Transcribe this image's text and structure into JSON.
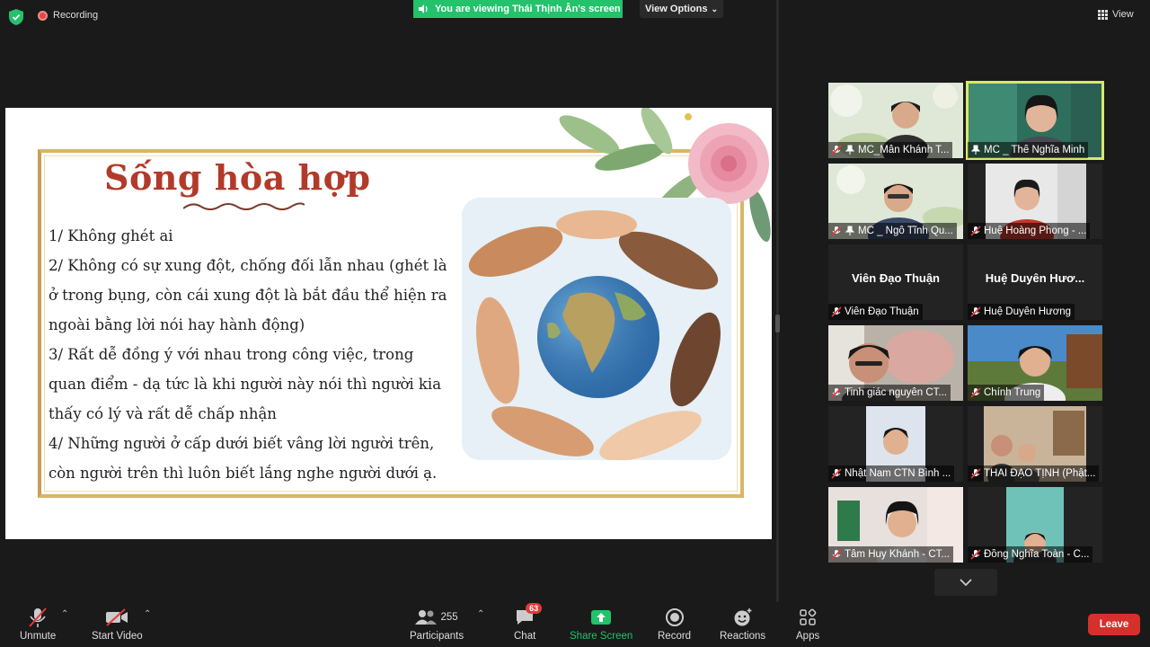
{
  "topbar": {
    "recording_label": "Recording",
    "viewing_banner": "You are viewing Thái Thịnh Ân's screen",
    "view_options_label": "View Options",
    "view_label": "View"
  },
  "slide": {
    "title": "Sống hòa hợp",
    "points": [
      "1/ Không ghét ai",
      "2/ Không có sự xung đột, chống đối lẫn nhau (ghét là",
      "ở trong bụng, còn cái xung đột là bắt đầu thể hiện ra",
      "ngoài bằng lời nói hay hành động)",
      "3/ Rất dễ đồng ý với nhau trong công việc, trong",
      "quan điểm - dạ tức là khi người này nói thì người kia",
      "thấy có lý và rất dễ chấp nhận",
      "4/ Những người ở cấp dưới biết vâng lời người trên,",
      "còn người trên thì luôn biết lắng nghe người dưới ạ."
    ]
  },
  "gallery": {
    "tiles": [
      {
        "name": "MC_Mẫn Khánh T...",
        "video": true
      },
      {
        "name": "MC _ Thể Nghĩa Minh",
        "video": true,
        "active": true
      },
      {
        "name": "MC _ Ngô Tĩnh Qu...",
        "video": true
      },
      {
        "name": "Huệ Hoàng Phong - ...",
        "video": true
      },
      {
        "name": "Viên Đạo Thuận",
        "video": false,
        "big": "Viên Đạo Thuận"
      },
      {
        "name": "Huệ Duyên Hương",
        "video": false,
        "big": "Huệ  Duyên  Hươ..."
      },
      {
        "name": "Tinh giác nguyên CT...",
        "video": true
      },
      {
        "name": "Chính Trung",
        "video": true
      },
      {
        "name": "Nhật Nam CTN Bình ...",
        "video": true
      },
      {
        "name": "THÁI ĐẠO TỊNH (Phật...",
        "video": true
      },
      {
        "name": "Tâm Huy Khánh - CT...",
        "video": true
      },
      {
        "name": "Đồng Nghĩa Toàn - C...",
        "video": true
      }
    ]
  },
  "toolbar": {
    "unmute": "Unmute",
    "start_video": "Start Video",
    "participants": "Participants",
    "participants_count": "255",
    "chat": "Chat",
    "chat_badge": "63",
    "share_screen": "Share Screen",
    "record": "Record",
    "reactions": "Reactions",
    "apps": "Apps",
    "leave": "Leave"
  },
  "colors": {
    "share_green": "#23c26b",
    "leave_red": "#d6302c",
    "title_red": "#b23a2a",
    "active_border": "#d8e86a"
  }
}
